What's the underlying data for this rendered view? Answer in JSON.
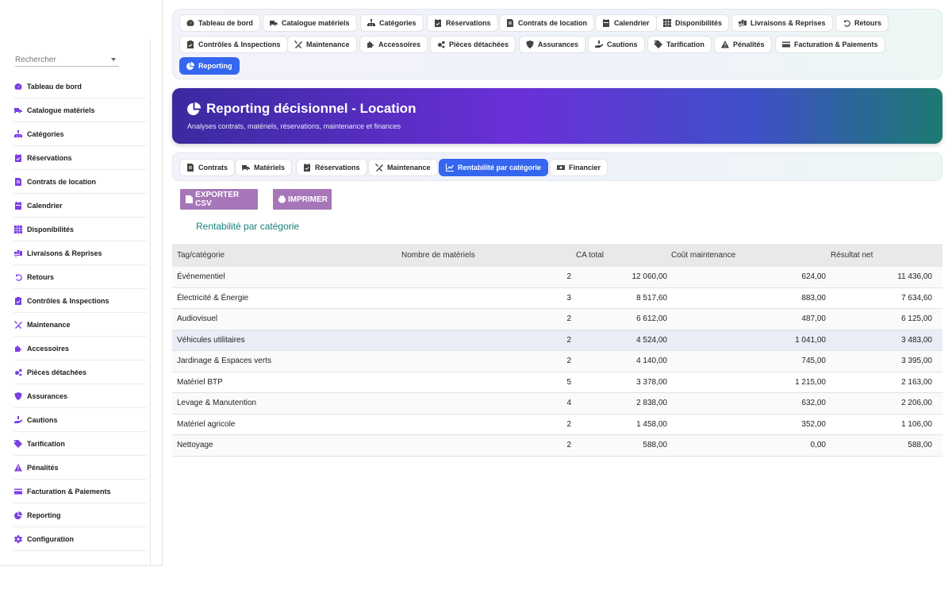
{
  "sidebar": {
    "search_placeholder": "Rechercher",
    "items": [
      {
        "label": "Tableau de bord",
        "icon": "gauge-icon"
      },
      {
        "label": "Catalogue matériels",
        "icon": "truck-icon"
      },
      {
        "label": "Catégories",
        "icon": "sitemap-icon"
      },
      {
        "label": "Réservations",
        "icon": "calendar-check-icon"
      },
      {
        "label": "Contrats de location",
        "icon": "file-contract-icon"
      },
      {
        "label": "Calendrier",
        "icon": "calendar-icon"
      },
      {
        "label": "Disponibilités",
        "icon": "grid-icon"
      },
      {
        "label": "Livraisons & Reprises",
        "icon": "truck-loading-icon"
      },
      {
        "label": "Retours",
        "icon": "undo-icon"
      },
      {
        "label": "Contrôles & Inspections",
        "icon": "clipboard-check-icon"
      },
      {
        "label": "Maintenance",
        "icon": "tools-icon"
      },
      {
        "label": "Accessoires",
        "icon": "puzzle-icon"
      },
      {
        "label": "Pièces détachées",
        "icon": "cogs-icon"
      },
      {
        "label": "Assurances",
        "icon": "shield-icon"
      },
      {
        "label": "Cautions",
        "icon": "hand-holding-icon"
      },
      {
        "label": "Tarification",
        "icon": "tags-icon"
      },
      {
        "label": "Pénalités",
        "icon": "warning-icon"
      },
      {
        "label": "Facturation & Paiements",
        "icon": "credit-card-icon"
      },
      {
        "label": "Reporting",
        "icon": "chart-pie-icon"
      },
      {
        "label": "Configuration",
        "icon": "cog-icon"
      }
    ]
  },
  "topnav": {
    "row1": [
      "Tableau de bord",
      "Catalogue matériels",
      "Catégories",
      "Réservations",
      "Contrats de location",
      "Calendrier",
      "Disponibilités",
      "Livraisons & Reprises",
      "Retours"
    ],
    "row2": [
      "Contrôles & Inspections",
      "Maintenance",
      "Accessoires",
      "Pièces détachées",
      "Assurances",
      "Cautions",
      "Tarification",
      "Pénalités",
      "Facturation & Paiements"
    ],
    "row3": [
      "Reporting"
    ],
    "active": "Reporting"
  },
  "banner": {
    "title": "Reporting décisionnel - Location",
    "subtitle": "Analyses contrats, matériels, réservations, maintenance et finances"
  },
  "subtabs": {
    "items": [
      "Contrats",
      "Matériels",
      "Réservations",
      "Maintenance",
      "Rentabilité par catégorie",
      "Financier"
    ],
    "active": "Rentabilité par catégorie"
  },
  "actions": {
    "export_label": "EXPORTER CSV",
    "print_label": "IMPRIMER"
  },
  "section": {
    "title": "Rentabilité par catégorie"
  },
  "table": {
    "headers": [
      "Tag/catégorie",
      "Nombre de matériels",
      "CA total",
      "Coût maintenance",
      "Résultat net"
    ],
    "rows": [
      [
        "Événementiel",
        "2",
        "12 060,00",
        "624,00",
        "11 436,00"
      ],
      [
        "Électricité & Énergie",
        "3",
        "8 517,60",
        "883,00",
        "7 634,60"
      ],
      [
        "Audiovisuel",
        "2",
        "6 612,00",
        "487,00",
        "6 125,00"
      ],
      [
        "Véhicules utilitaires",
        "2",
        "4 524,00",
        "1 041,00",
        "3 483,00"
      ],
      [
        "Jardinage & Espaces verts",
        "2",
        "4 140,00",
        "745,00",
        "3 395,00"
      ],
      [
        "Matériel BTP",
        "5",
        "3 378,00",
        "1 215,00",
        "2 163,00"
      ],
      [
        "Levage & Manutention",
        "4",
        "2 838,00",
        "632,00",
        "2 206,00"
      ],
      [
        "Matériel agricole",
        "2",
        "1 458,00",
        "352,00",
        "1 106,00"
      ],
      [
        "Nettoyage",
        "2",
        "588,00",
        "0,00",
        "588,00"
      ]
    ]
  }
}
